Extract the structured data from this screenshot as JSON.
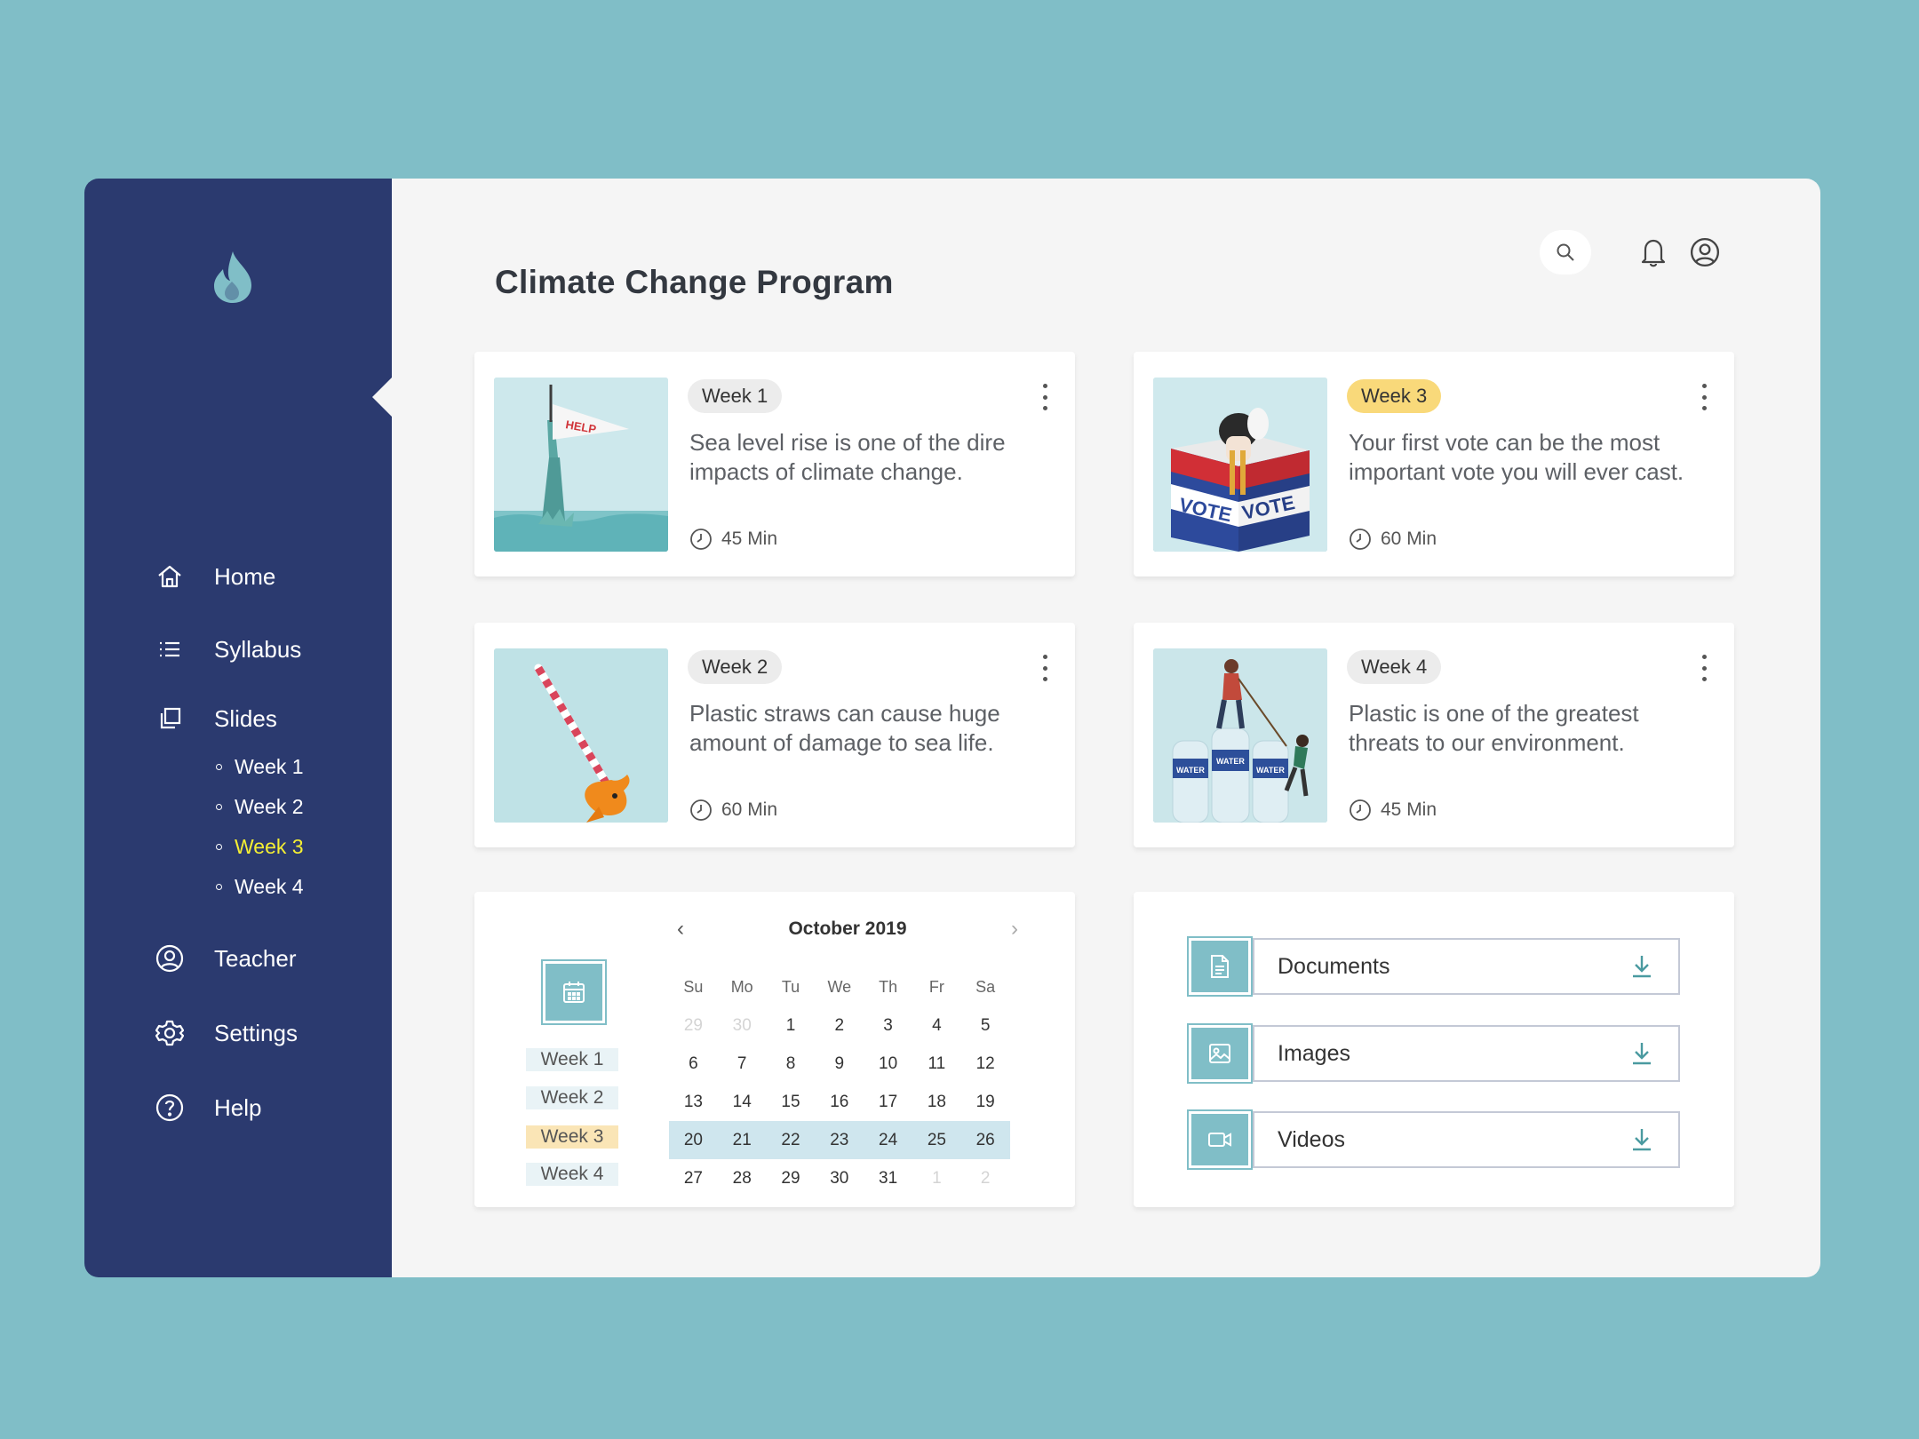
{
  "colors": {
    "background": "#80bec7",
    "sidebar": "#2b3a6f",
    "accent": "#80bec7",
    "active_sub": "#f5ef33",
    "badge_highlight": "#f9d97a"
  },
  "sidebar": {
    "logo_icon": "flame-drop-icon",
    "items": [
      {
        "label": "Home",
        "icon": "home-icon"
      },
      {
        "label": "Syllabus",
        "icon": "list-icon"
      },
      {
        "label": "Slides",
        "icon": "slides-icon"
      },
      {
        "label": "Teacher",
        "icon": "user-circle-icon"
      },
      {
        "label": "Settings",
        "icon": "gear-icon"
      },
      {
        "label": "Help",
        "icon": "help-icon"
      }
    ],
    "slides_sub": [
      "Week 1",
      "Week 2",
      "Week 3",
      "Week 4"
    ],
    "active_item": "Home",
    "active_sub": "Week 3"
  },
  "header": {
    "title": "Climate Change Program"
  },
  "cards": [
    {
      "week": "Week 1",
      "text": "Sea level rise is one of the dire impacts of climate change.",
      "duration": "45 Min",
      "flag_text": "HELP"
    },
    {
      "week": "Week 3",
      "text": "Your first vote can be the most important vote you will ever cast.",
      "duration": "60 Min",
      "box_text": "VOTE"
    },
    {
      "week": "Week 2",
      "text": "Plastic straws can cause huge amount of damage to sea life.",
      "duration": "60 Min"
    },
    {
      "week": "Week 4",
      "text": "Plastic is one of the greatest threats to our environment.",
      "duration": "45 Min",
      "bottle_text": "WATER"
    }
  ],
  "calendar": {
    "month": "October 2019",
    "weekdays": [
      "Su",
      "Mo",
      "Tu",
      "We",
      "Th",
      "Fr",
      "Sa"
    ],
    "weeks_labels": [
      "Week 1",
      "Week 2",
      "Week 3",
      "Week 4"
    ],
    "highlighted_week": "Week 3",
    "rows": [
      [
        "29",
        "30",
        "1",
        "2",
        "3",
        "4",
        "5"
      ],
      [
        "6",
        "7",
        "8",
        "9",
        "10",
        "11",
        "12"
      ],
      [
        "13",
        "14",
        "15",
        "16",
        "17",
        "18",
        "19"
      ],
      [
        "20",
        "21",
        "22",
        "23",
        "24",
        "25",
        "26"
      ],
      [
        "27",
        "28",
        "29",
        "30",
        "31",
        "1",
        "2"
      ]
    ]
  },
  "resources": [
    {
      "label": "Documents",
      "icon": "document-icon"
    },
    {
      "label": "Images",
      "icon": "image-icon"
    },
    {
      "label": "Videos",
      "icon": "video-icon"
    }
  ]
}
